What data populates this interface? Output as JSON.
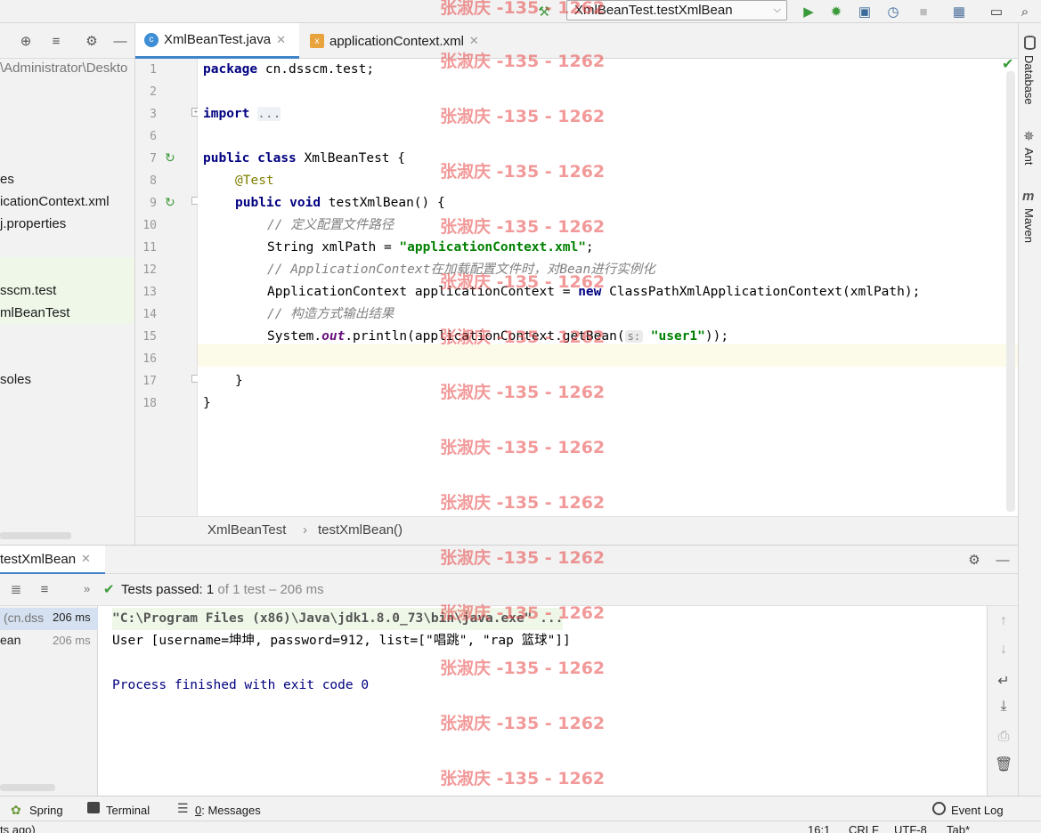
{
  "toolbar": {
    "run_config": "XmlBeanTest.testXmlBean"
  },
  "project": {
    "path_fragment": "\\Administrator\\Deskto",
    "items": [
      {
        "label": "es"
      },
      {
        "label": "icationContext.xml"
      },
      {
        "label": "j.properties"
      },
      {
        "label": "sscm.test"
      },
      {
        "label": "mlBeanTest"
      },
      {
        "label": "soles"
      }
    ]
  },
  "tabs": [
    {
      "label": "XmlBeanTest.java",
      "active": true
    },
    {
      "label": "applicationContext.xml",
      "active": false
    }
  ],
  "editor": {
    "line_numbers": [
      "1",
      "2",
      "3",
      "6",
      "7",
      "8",
      "9",
      "10",
      "11",
      "12",
      "13",
      "14",
      "15",
      "16",
      "17",
      "18"
    ],
    "code": {
      "l1_kw": "package",
      "l1_rest": " cn.dsscm.test;",
      "l3_kw": "import",
      "l3_fold": "...",
      "l7_kw1": "public",
      "l7_kw2": "class",
      "l7_rest": " XmlBeanTest {",
      "l8_ann": "@Test",
      "l9_kw1": "public",
      "l9_kw2": "void",
      "l9_rest": " testXmlBean() {",
      "l10_cm": "// 定义配置文件路径",
      "l11_pre": "String xmlPath = ",
      "l11_str": "\"applicationContext.xml\"",
      "l11_post": ";",
      "l12_cm": "// ApplicationContext在加载配置文件时，对Bean进行实例化",
      "l13_pre": "ApplicationContext applicationContext = ",
      "l13_kw": "new",
      "l13_post": " ClassPathXmlApplicationContext(xmlPath);",
      "l14_cm": "// 构造方式输出结果",
      "l15_pre": "System.",
      "l15_fld": "out",
      "l15_mid": ".println(applicationContext.getBean(",
      "l15_hint": "s:",
      "l15_str": "\"user1\"",
      "l15_post": "));",
      "l17": "}",
      "l18": "}"
    }
  },
  "breadcrumbs": {
    "class": "XmlBeanTest",
    "sep": "›",
    "method": "testXmlBean()"
  },
  "right_tools": {
    "database": "Database",
    "ant": "Ant",
    "maven": "Maven"
  },
  "run": {
    "tab_label": "testXmlBean",
    "status_prefix": "Tests passed:",
    "status_count": "1",
    "status_suffix": "of 1 test – 206 ms",
    "tree": [
      {
        "label": "(cn.dss",
        "time": "206 ms"
      },
      {
        "label": "ean",
        "time": "206 ms"
      }
    ],
    "console": {
      "cmd": "\"C:\\Program Files (x86)\\Java\\jdk1.8.0_73\\bin\\java.exe\" ...",
      "output": "User [username=坤坤, password=912, list=[\"唱跳\", \"rap 篮球\"]]",
      "exit": "Process finished with exit code 0"
    }
  },
  "bottom_tools": {
    "spring": "Spring",
    "terminal": "Terminal",
    "messages_num": "0",
    "messages": ": Messages",
    "event_log": "Event Log"
  },
  "status": {
    "left": "ts ago)",
    "position": "16:1",
    "line_sep": "CRLF",
    "encoding": "UTF-8",
    "indent": "Tab*"
  },
  "watermark": "张淑庆 -135 - 1262"
}
